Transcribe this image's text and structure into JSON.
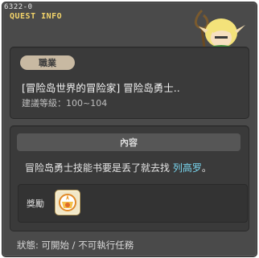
{
  "window": {
    "quest_id": "6322-0",
    "quest_info_label": "QUEST INFO"
  },
  "top_panel": {
    "job_label": "職業",
    "quest_title": "[冒险岛世界的冒险家] 冒险岛勇士..",
    "level_text": "建議等級：100~104"
  },
  "content_panel": {
    "section_label": "內容",
    "description_prefix": "冒险岛勇士技能书要是丢了就去找 ",
    "npc_name": "列高罗",
    "description_suffix": "。",
    "reward_label": "獎勵",
    "reward_icon": "skill-book-icon"
  },
  "status": {
    "text": "狀態: 可開始 / 不可執行任務"
  },
  "colors": {
    "window_bg": "#4a4a4a",
    "panel_bg": "#3a3a3a",
    "header_gold": "#f2d36a",
    "npc_highlight": "#79d7f0",
    "job_pill": "#c8b9a2"
  }
}
